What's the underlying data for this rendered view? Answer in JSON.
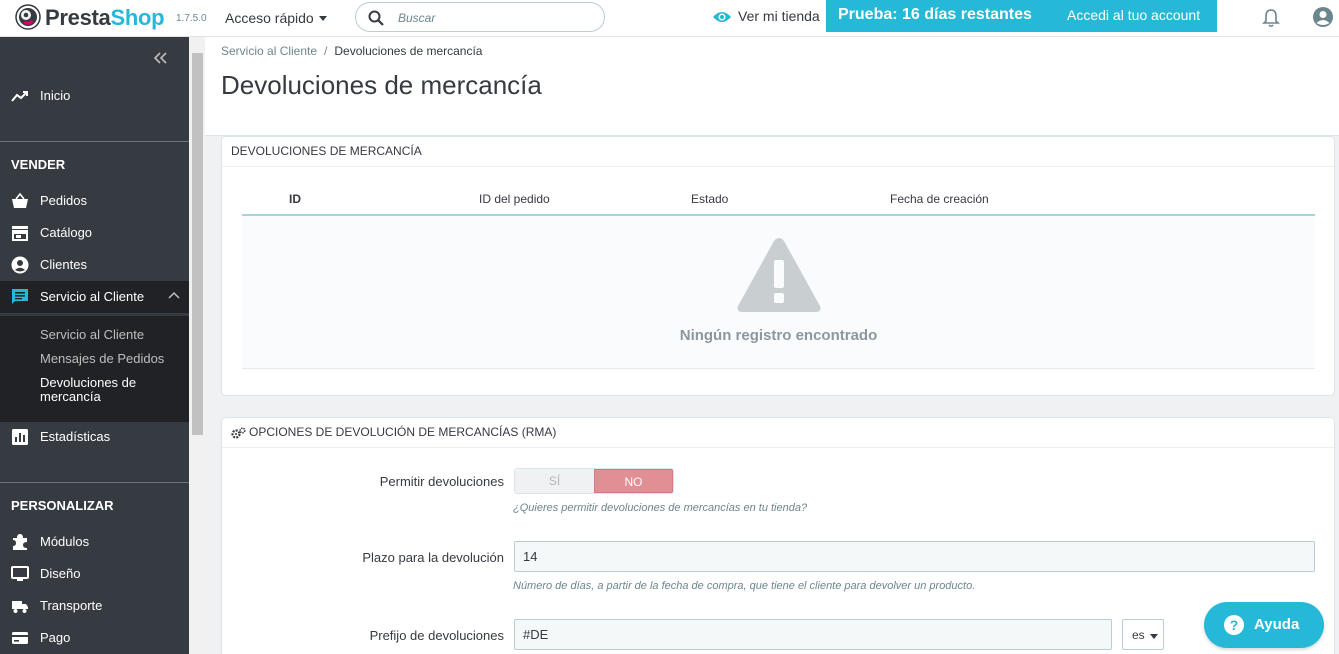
{
  "header": {
    "brand_a": "Presta",
    "brand_b": "Shop",
    "version": "1.7.5.0",
    "quick_access": "Acceso rápido",
    "search_placeholder": "Buscar",
    "view_shop": "Ver mi tienda",
    "trial_text": "Prueba: 16 días restantes",
    "trial_link": "Accedi al tuo account",
    "accent_color": "#25b9d7"
  },
  "sidebar": {
    "home": "Inicio",
    "section_sell": "VENDER",
    "orders": "Pedidos",
    "catalog": "Catálogo",
    "customers": "Clientes",
    "customer_service": "Servicio al Cliente",
    "sub_customer_service": "Servicio al Cliente",
    "sub_order_messages": "Mensajes de Pedidos",
    "sub_returns_1": "Devoluciones de",
    "sub_returns_2": "mercancía",
    "stats": "Estadísticas",
    "section_customize": "PERSONALIZAR",
    "modules": "Módulos",
    "design": "Diseño",
    "shipping": "Transporte",
    "payment": "Pago"
  },
  "breadcrumb": {
    "parent": "Servicio al Cliente",
    "separator": "/",
    "current": "Devoluciones de mercancía"
  },
  "page_title": "Devoluciones de mercancía",
  "returns_panel": {
    "title": "DEVOLUCIONES DE MERCANCÍA",
    "columns": [
      "ID",
      "ID del pedido",
      "Estado",
      "Fecha de creación"
    ],
    "empty_message": "Ningún registro encontrado"
  },
  "options_panel": {
    "title": "OPCIONES DE DEVOLUCIÓN DE MERCANCÍAS (RMA)",
    "allow_label": "Permitir devoluciones",
    "yes": "SÍ",
    "no": "NO",
    "allow_selected": "NO",
    "allow_help": "¿Quieres permitir devoluciones de mercancías en tu tienda?",
    "deadline_label": "Plazo para la devolución",
    "deadline_value": "14",
    "deadline_help": "Número de días, a partir de la fecha de compra, que tiene el cliente para devolver un producto.",
    "prefix_label": "Prefijo de devoluciones",
    "prefix_value": "#DE",
    "language": "es"
  },
  "help_button": "Ayuda"
}
